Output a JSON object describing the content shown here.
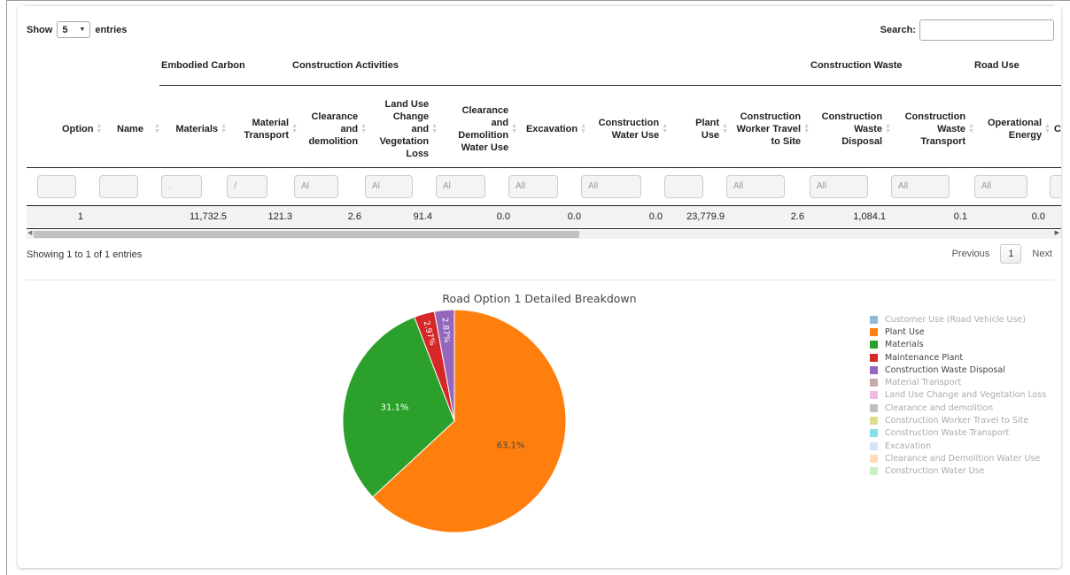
{
  "length": {
    "show": "Show",
    "value": "5",
    "entries": "entries"
  },
  "search": {
    "label": "Search:",
    "value": ""
  },
  "groups": [
    "Embodied Carbon",
    "Construction Activities",
    "Construction Waste",
    "Road Use"
  ],
  "headers": [
    {
      "label": "Option"
    },
    {
      "label": "Name"
    },
    {
      "label": "Materials"
    },
    {
      "label": "Material Transport"
    },
    {
      "label": "Clearance and demolition"
    },
    {
      "label": "Land Use Change and Vegetation Loss"
    },
    {
      "label": "Clearance and Demolition Water Use"
    },
    {
      "label": "Excavation"
    },
    {
      "label": "Construction Water Use"
    },
    {
      "label": "Plant Use"
    },
    {
      "label": "Construction Worker Travel to Site"
    },
    {
      "label": "Construction Waste Disposal"
    },
    {
      "label": "Construction Waste Transport"
    },
    {
      "label": "Operational Energy"
    },
    {
      "label": "C"
    }
  ],
  "filters": [
    "",
    "",
    ".",
    "/",
    "Al",
    "Al",
    "Al",
    "All",
    "All",
    "",
    "All",
    "All",
    "All",
    "All",
    ""
  ],
  "row": [
    "1",
    "",
    "11,732.5",
    "121.3",
    "2.6",
    "91.4",
    "0.0",
    "0.0",
    "0.0",
    "23,779.9",
    "2.6",
    "1,084.1",
    "0.1",
    "0.0"
  ],
  "info": "Showing 1 to 1 of 1 entries",
  "pager": {
    "previous": "Previous",
    "page": "1",
    "next": "Next"
  },
  "chart_data": {
    "type": "pie",
    "title": "Road Option 1 Detailed Breakdown",
    "slices": [
      {
        "label": "Customer Use (Road Vehicle Use)",
        "percent": 0.0,
        "color": "#1f77b4",
        "hidden": true
      },
      {
        "label": "Plant Use",
        "percent": 63.1,
        "color": "#ff7f0e",
        "hidden": false
      },
      {
        "label": "Materials",
        "percent": 31.1,
        "color": "#2ca02c",
        "hidden": false
      },
      {
        "label": "Maintenance Plant",
        "percent": 2.97,
        "color": "#d62728",
        "hidden": false
      },
      {
        "label": "Construction Waste Disposal",
        "percent": 2.87,
        "color": "#9467bd",
        "hidden": false
      },
      {
        "label": "Material Transport",
        "percent": 0.0,
        "color": "#8c564b",
        "hidden": true
      },
      {
        "label": "Land Use Change and Vegetation Loss",
        "percent": 0.0,
        "color": "#e377c2",
        "hidden": true
      },
      {
        "label": "Clearance and demolition",
        "percent": 0.0,
        "color": "#7f7f7f",
        "hidden": true
      },
      {
        "label": "Construction Worker Travel to Site",
        "percent": 0.0,
        "color": "#bcbd22",
        "hidden": true
      },
      {
        "label": "Construction Waste Transport",
        "percent": 0.0,
        "color": "#17becf",
        "hidden": true
      },
      {
        "label": "Excavation",
        "percent": 0.0,
        "color": "#aec7e8",
        "hidden": true
      },
      {
        "label": "Clearance and Demolition Water Use",
        "percent": 0.0,
        "color": "#ffbb78",
        "hidden": true
      },
      {
        "label": "Construction Water Use",
        "percent": 0.0,
        "color": "#98df8a",
        "hidden": true
      }
    ],
    "data_labels": [
      "63.1%",
      "31.1%",
      "2.97%",
      "2.87%"
    ]
  }
}
